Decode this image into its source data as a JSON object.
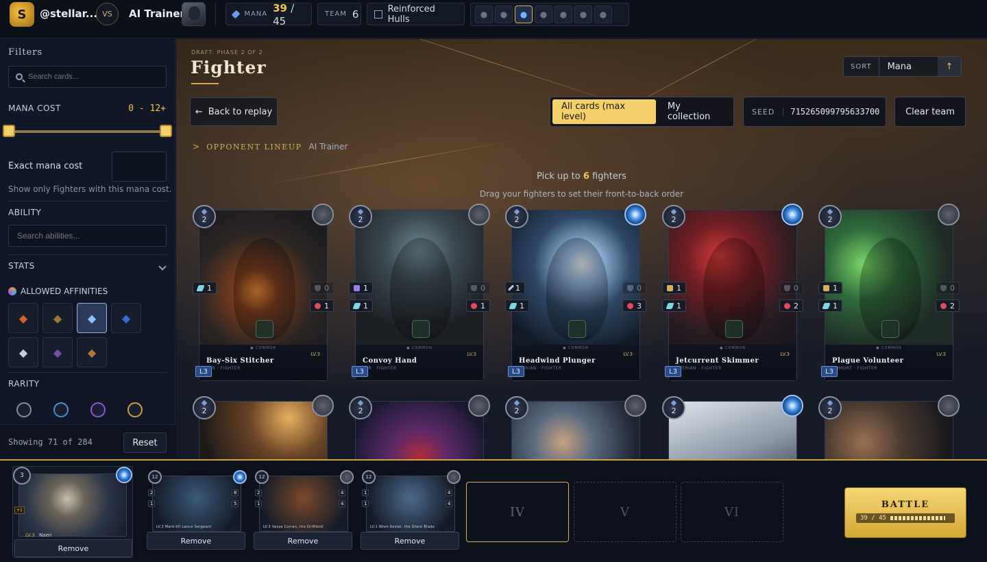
{
  "header": {
    "username": "@stellar...",
    "vs_label": "VS",
    "opponent_name": "AI Trainer",
    "mana_label": "MANA",
    "mana_value": "39",
    "mana_sep": "/",
    "mana_max": "45",
    "team_label": "TEAM",
    "team_value": "6",
    "ruleset": "Reinforced Hulls",
    "affinity_icons": [
      "fire-icon",
      "earth-icon",
      "water-icon",
      "death-icon",
      "light-icon",
      "dragon-icon",
      "neutral-icon"
    ],
    "active_affinity": "water-icon"
  },
  "sidebar": {
    "title": "Filters",
    "search_placeholder": "Search cards...",
    "mana_cost_label": "MANA COST",
    "mana_range": "0 - 12+",
    "exact_mana_label": "Exact mana cost",
    "exact_hint": "Show only Fighters with this mana cost.",
    "ability_label": "ABILITY",
    "ability_placeholder": "Search abilities...",
    "stats_label": "STATS",
    "allowed_label": "ALLOWED AFFINITIES",
    "affinities": [
      {
        "name": "fire",
        "color": "#e05a2a",
        "selected": false
      },
      {
        "name": "earth",
        "color": "#9a7a30",
        "selected": false
      },
      {
        "name": "water",
        "color": "#8cc4ff",
        "selected": true
      },
      {
        "name": "death",
        "color": "#3a6ad0",
        "selected": false
      },
      {
        "name": "light",
        "color": "#c8ccd8",
        "selected": false
      },
      {
        "name": "dragon",
        "color": "#7a4ab0",
        "selected": false
      },
      {
        "name": "neutral",
        "color": "#b07830",
        "selected": false
      }
    ],
    "rarity_label": "RARITY",
    "rarities": [
      {
        "name": "common",
        "color": "#8a8f9c"
      },
      {
        "name": "rare",
        "color": "#4f8fd8"
      },
      {
        "name": "epic",
        "color": "#8a5ad0"
      },
      {
        "name": "legendary",
        "color": "#c9a23e"
      }
    ],
    "showing": "Showing 71 of 284",
    "reset": "Reset"
  },
  "main": {
    "phase": "DRAFT: PHASE 2 OF 2",
    "title": "Fighter",
    "sort_label": "SORT",
    "sort_value": "Mana",
    "back_label": "Back to replay",
    "toggle": [
      "All cards (max level)",
      "My collection"
    ],
    "toggle_active": 0,
    "seed_label": "SEED",
    "seed_value": "715265099795633700",
    "clear_team": "Clear team",
    "opponent_lineup_label": "OPPONENT LINEUP",
    "opponent_lineup_name": "AI Trainer",
    "pick_prefix": "Pick up to",
    "pick_count": "6",
    "pick_suffix": "fighters",
    "drag_hint": "Drag your fighters to set their front-to-back order"
  },
  "cards": [
    {
      "name": "Bay-Six Stitcher",
      "sub": "TER · FIGHTER",
      "level": "LV.3",
      "badge": "L3",
      "rarity": "COMMON",
      "mana": "2",
      "affinity": "neutral",
      "stats": [
        {
          "type": "arm",
          "v": "0",
          "side": "r"
        },
        {
          "type": "spd",
          "v": "1",
          "side": "l"
        },
        {
          "type": "heart",
          "v": "1",
          "side": "r"
        },
        {
          "type": "none",
          "v": "0",
          "side": "l"
        }
      ],
      "art": "a1"
    },
    {
      "name": "Convoy Hand",
      "sub": "TER · FIGHTER",
      "level": "LV.3",
      "badge": "L3",
      "rarity": "COMMON",
      "mana": "2",
      "affinity": "neutral",
      "stats": [
        {
          "type": "mag2",
          "v": "1",
          "side": "l"
        },
        {
          "type": "arm",
          "v": "0",
          "side": "r"
        },
        {
          "type": "spd",
          "v": "1",
          "side": "l"
        },
        {
          "type": "heart",
          "v": "1",
          "side": "r"
        }
      ],
      "art": "a2"
    },
    {
      "name": "Headwind Plunger",
      "sub": "HERIAN · FIGHTER",
      "level": "LV.3",
      "badge": "L3",
      "rarity": "COMMON",
      "mana": "2",
      "affinity": "water",
      "stats": [
        {
          "type": "atk",
          "v": "1",
          "side": "l"
        },
        {
          "type": "arm",
          "v": "0",
          "side": "r"
        },
        {
          "type": "spd",
          "v": "1",
          "side": "l"
        },
        {
          "type": "heart",
          "v": "3",
          "side": "r"
        }
      ],
      "art": "a3"
    },
    {
      "name": "Jetcurrent Skimmer",
      "sub": "THERIAN · FIGHTER",
      "level": "LV.3",
      "badge": "L3",
      "rarity": "COMMON",
      "mana": "2",
      "affinity": "water",
      "stats": [
        {
          "type": "rng",
          "v": "1",
          "side": "l"
        },
        {
          "type": "arm",
          "v": "0",
          "side": "r"
        },
        {
          "type": "spd",
          "v": "1",
          "side": "l"
        },
        {
          "type": "heart",
          "v": "2",
          "side": "r"
        }
      ],
      "art": "a4"
    },
    {
      "name": "Plague Volunteer",
      "sub": "UNMORT · FIGHTER",
      "level": "LV.3",
      "badge": "L3",
      "rarity": "COMMON",
      "mana": "2",
      "affinity": "neutral",
      "stats": [
        {
          "type": "rng",
          "v": "1",
          "side": "l"
        },
        {
          "type": "arm",
          "v": "0",
          "side": "r"
        },
        {
          "type": "spd",
          "v": "1",
          "side": "l"
        },
        {
          "type": "heart",
          "v": "2",
          "side": "r"
        }
      ],
      "art": "a5"
    }
  ],
  "cards_row2": [
    {
      "mana": "2",
      "affinity": "neutral",
      "art": "a6"
    },
    {
      "mana": "2",
      "affinity": "neutral",
      "art": "a7"
    },
    {
      "mana": "2",
      "affinity": "neutral",
      "art": "a8"
    },
    {
      "mana": "2",
      "affinity": "water",
      "art": "a9"
    },
    {
      "mana": "2",
      "affinity": "neutral",
      "art": "a10"
    }
  ],
  "tray": {
    "leader": {
      "mana": "3",
      "level": "LV.3",
      "name": "Naeri",
      "buff": "+1",
      "remove": "Remove"
    },
    "slots": [
      {
        "mana": "12",
        "name": "Mark-VII Lance Sergeant",
        "level": "LV.3",
        "affinity": "water",
        "remove": "Remove",
        "art": "#3a5a7a",
        "stats": [
          "2",
          "1",
          "8",
          "5"
        ]
      },
      {
        "mana": "12",
        "name": "Vessa Corran, the Driftlord",
        "level": "LV.3",
        "affinity": "neutral",
        "remove": "Remove",
        "art": "#7a4a2a",
        "stats": [
          "2",
          "1",
          "4",
          "4"
        ]
      },
      {
        "mana": "12",
        "name": "Wren Kestel, the Silent Blade",
        "level": "LV.1",
        "affinity": "neutral",
        "remove": "Remove",
        "art": "#4a6a8a",
        "stats": [
          "1",
          "1",
          "4",
          "4"
        ]
      }
    ],
    "empty_slots": [
      "IV",
      "V",
      "VI"
    ],
    "battle_label": "BATTLE",
    "battle_mana": "39 / 45"
  }
}
